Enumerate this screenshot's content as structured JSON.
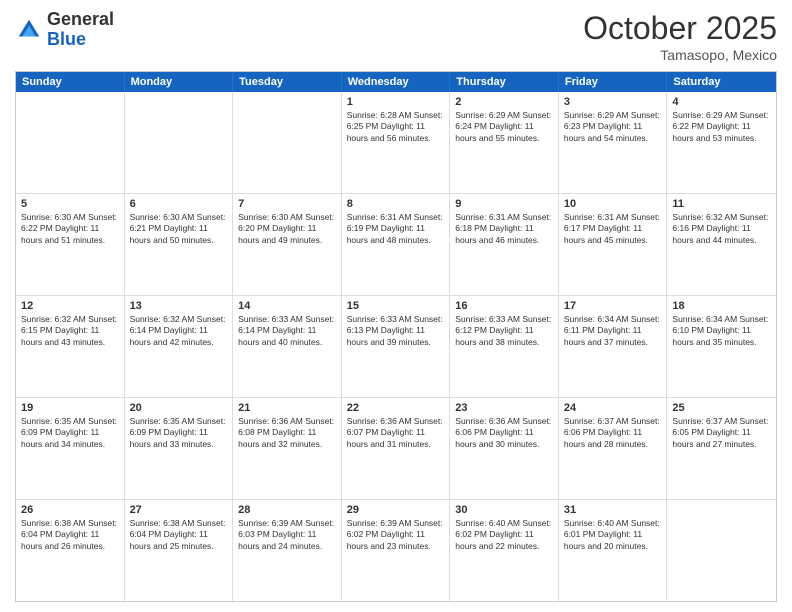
{
  "header": {
    "logo_general": "General",
    "logo_blue": "Blue",
    "month_title": "October 2025",
    "location": "Tamasopo, Mexico"
  },
  "day_headers": [
    "Sunday",
    "Monday",
    "Tuesday",
    "Wednesday",
    "Thursday",
    "Friday",
    "Saturday"
  ],
  "weeks": [
    [
      {
        "day": "",
        "info": ""
      },
      {
        "day": "",
        "info": ""
      },
      {
        "day": "",
        "info": ""
      },
      {
        "day": "1",
        "info": "Sunrise: 6:28 AM\nSunset: 6:25 PM\nDaylight: 11 hours and 56 minutes."
      },
      {
        "day": "2",
        "info": "Sunrise: 6:29 AM\nSunset: 6:24 PM\nDaylight: 11 hours and 55 minutes."
      },
      {
        "day": "3",
        "info": "Sunrise: 6:29 AM\nSunset: 6:23 PM\nDaylight: 11 hours and 54 minutes."
      },
      {
        "day": "4",
        "info": "Sunrise: 6:29 AM\nSunset: 6:22 PM\nDaylight: 11 hours and 53 minutes."
      }
    ],
    [
      {
        "day": "5",
        "info": "Sunrise: 6:30 AM\nSunset: 6:22 PM\nDaylight: 11 hours and 51 minutes."
      },
      {
        "day": "6",
        "info": "Sunrise: 6:30 AM\nSunset: 6:21 PM\nDaylight: 11 hours and 50 minutes."
      },
      {
        "day": "7",
        "info": "Sunrise: 6:30 AM\nSunset: 6:20 PM\nDaylight: 11 hours and 49 minutes."
      },
      {
        "day": "8",
        "info": "Sunrise: 6:31 AM\nSunset: 6:19 PM\nDaylight: 11 hours and 48 minutes."
      },
      {
        "day": "9",
        "info": "Sunrise: 6:31 AM\nSunset: 6:18 PM\nDaylight: 11 hours and 46 minutes."
      },
      {
        "day": "10",
        "info": "Sunrise: 6:31 AM\nSunset: 6:17 PM\nDaylight: 11 hours and 45 minutes."
      },
      {
        "day": "11",
        "info": "Sunrise: 6:32 AM\nSunset: 6:16 PM\nDaylight: 11 hours and 44 minutes."
      }
    ],
    [
      {
        "day": "12",
        "info": "Sunrise: 6:32 AM\nSunset: 6:15 PM\nDaylight: 11 hours and 43 minutes."
      },
      {
        "day": "13",
        "info": "Sunrise: 6:32 AM\nSunset: 6:14 PM\nDaylight: 11 hours and 42 minutes."
      },
      {
        "day": "14",
        "info": "Sunrise: 6:33 AM\nSunset: 6:14 PM\nDaylight: 11 hours and 40 minutes."
      },
      {
        "day": "15",
        "info": "Sunrise: 6:33 AM\nSunset: 6:13 PM\nDaylight: 11 hours and 39 minutes."
      },
      {
        "day": "16",
        "info": "Sunrise: 6:33 AM\nSunset: 6:12 PM\nDaylight: 11 hours and 38 minutes."
      },
      {
        "day": "17",
        "info": "Sunrise: 6:34 AM\nSunset: 6:11 PM\nDaylight: 11 hours and 37 minutes."
      },
      {
        "day": "18",
        "info": "Sunrise: 6:34 AM\nSunset: 6:10 PM\nDaylight: 11 hours and 35 minutes."
      }
    ],
    [
      {
        "day": "19",
        "info": "Sunrise: 6:35 AM\nSunset: 6:09 PM\nDaylight: 11 hours and 34 minutes."
      },
      {
        "day": "20",
        "info": "Sunrise: 6:35 AM\nSunset: 6:09 PM\nDaylight: 11 hours and 33 minutes."
      },
      {
        "day": "21",
        "info": "Sunrise: 6:36 AM\nSunset: 6:08 PM\nDaylight: 11 hours and 32 minutes."
      },
      {
        "day": "22",
        "info": "Sunrise: 6:36 AM\nSunset: 6:07 PM\nDaylight: 11 hours and 31 minutes."
      },
      {
        "day": "23",
        "info": "Sunrise: 6:36 AM\nSunset: 6:06 PM\nDaylight: 11 hours and 30 minutes."
      },
      {
        "day": "24",
        "info": "Sunrise: 6:37 AM\nSunset: 6:06 PM\nDaylight: 11 hours and 28 minutes."
      },
      {
        "day": "25",
        "info": "Sunrise: 6:37 AM\nSunset: 6:05 PM\nDaylight: 11 hours and 27 minutes."
      }
    ],
    [
      {
        "day": "26",
        "info": "Sunrise: 6:38 AM\nSunset: 6:04 PM\nDaylight: 11 hours and 26 minutes."
      },
      {
        "day": "27",
        "info": "Sunrise: 6:38 AM\nSunset: 6:04 PM\nDaylight: 11 hours and 25 minutes."
      },
      {
        "day": "28",
        "info": "Sunrise: 6:39 AM\nSunset: 6:03 PM\nDaylight: 11 hours and 24 minutes."
      },
      {
        "day": "29",
        "info": "Sunrise: 6:39 AM\nSunset: 6:02 PM\nDaylight: 11 hours and 23 minutes."
      },
      {
        "day": "30",
        "info": "Sunrise: 6:40 AM\nSunset: 6:02 PM\nDaylight: 11 hours and 22 minutes."
      },
      {
        "day": "31",
        "info": "Sunrise: 6:40 AM\nSunset: 6:01 PM\nDaylight: 11 hours and 20 minutes."
      },
      {
        "day": "",
        "info": ""
      }
    ]
  ]
}
